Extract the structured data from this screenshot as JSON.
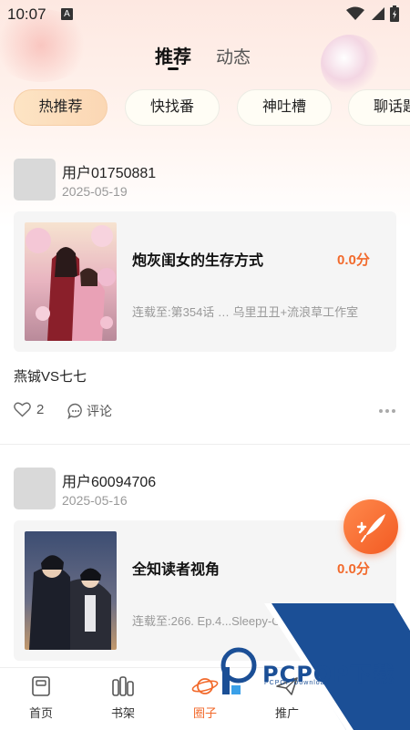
{
  "status_bar": {
    "time": "10:07",
    "notification_glyph": "A"
  },
  "top_tabs": {
    "recommend": "推荐",
    "dynamic": "动态"
  },
  "chips": [
    "热推荐",
    "快找番",
    "神吐槽",
    "聊话题"
  ],
  "posts": [
    {
      "username": "用户01750881",
      "date": "2025-05-19",
      "comic_title": "炮灰闺女的生存方式",
      "score": "0.0分",
      "meta": "连载至:第354话 …   乌里丑丑+流浪草工作室",
      "text": "燕铖VS七七",
      "likes": "2",
      "comment_label": "评论"
    },
    {
      "username": "用户60094706",
      "date": "2025-05-16",
      "comic_title": "全知读者视角",
      "score": "0.0分",
      "meta": "连载至:266. Ep.4...Sleepy-C"
    }
  ],
  "bottom_nav": [
    {
      "label": "首页",
      "icon": "home-icon"
    },
    {
      "label": "书架",
      "icon": "bookshelf-icon"
    },
    {
      "label": "圈子",
      "icon": "planet-icon"
    },
    {
      "label": "推广",
      "icon": "paper-plane-icon"
    }
  ],
  "watermark": {
    "brand": "PCPOP下载",
    "sub": "PCPOP Download"
  },
  "colors": {
    "accent": "#f26a2c",
    "watermark": "#1b4f96"
  }
}
